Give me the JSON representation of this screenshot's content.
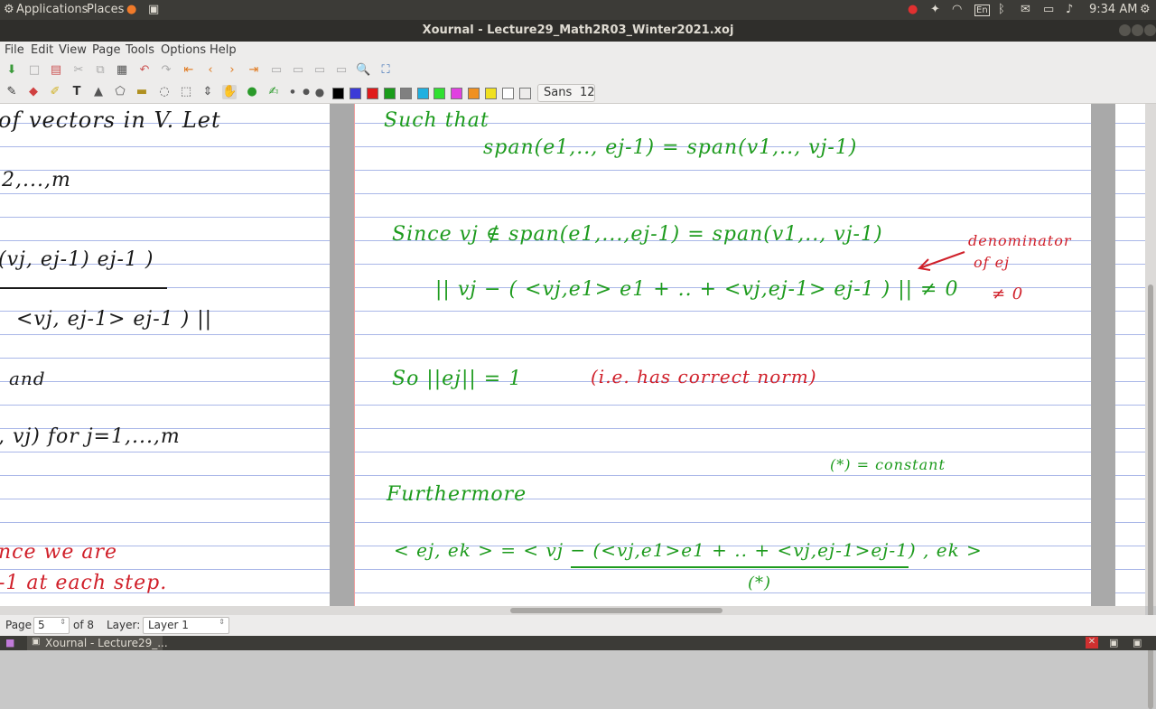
{
  "top_panel": {
    "applications": "Applications",
    "places": "Places",
    "time": "9:34 AM",
    "keyboard_layout": "En"
  },
  "window": {
    "title": "Xournal - Lecture29_Math2R03_Winter2021.xoj"
  },
  "menu": [
    "File",
    "Edit",
    "View",
    "Page",
    "Tools",
    "Options",
    "Help"
  ],
  "toolbar": {
    "font_name": "Sans",
    "font_size": "12",
    "colors": [
      "#000000",
      "#3b3bd8",
      "#e01b1b",
      "#1a9c1a",
      "#808080",
      "#20b0e0",
      "#30e030",
      "#e040e0",
      "#f09020",
      "#f0e020",
      "#ffffff"
    ]
  },
  "ink": {
    "left": [
      "of vectors in V. Let",
      "2,...,m",
      "(vj, ej-1) ej-1 )",
      "<vj, ej-1> ej-1 ) ||",
      "and",
      ", vj)  for  j=1,...,m",
      "nce we are",
      "-1 at each step."
    ],
    "right": {
      "line1": "Such that",
      "line2": "span(e1,.., ej-1) = span(v1,.., vj-1)",
      "line3": "Since  vj ∉ span(e1,...,ej-1) = span(v1,.., vj-1)",
      "line4": "|| vj − ( <vj,e1> e1 + .. + <vj,ej-1> ej-1 ) || ≠ 0",
      "line5": "So ||ej|| = 1",
      "line5_note": "(i.e. has correct norm)",
      "note_red_1": "denominator",
      "note_red_2": "of ej",
      "note_red_3": "≠ 0",
      "note_green": "(*) = constant",
      "line6": "Furthermore",
      "line7": "< ej, ek > = < vj − (<vj,e1>e1 + .. + <vj,ej-1>ej-1) , ek >",
      "line7_star": "(*)"
    }
  },
  "status": {
    "page_label": "Page",
    "page_value": "5",
    "page_total": "of 8",
    "layer_label": "Layer:",
    "layer_value": "Layer 1"
  },
  "taskbar": {
    "item": "Xournal - Lecture29_..."
  }
}
